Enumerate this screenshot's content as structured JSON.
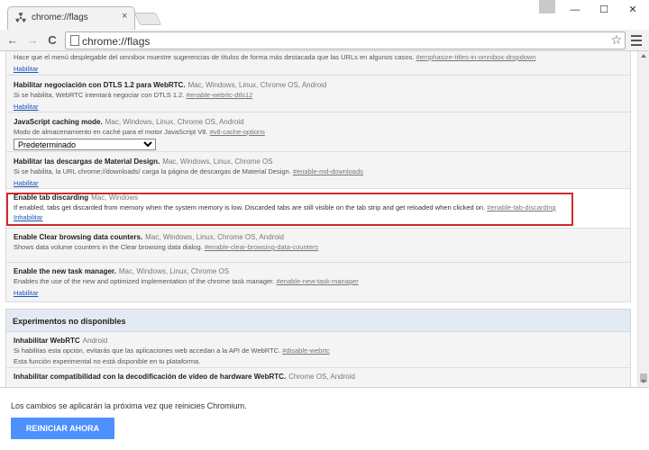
{
  "window": {
    "tab_title": "chrome://flags",
    "tab_close": "×",
    "minimize": "—",
    "maximize": "☐",
    "close": "✕"
  },
  "toolbar": {
    "back": "←",
    "forward": "→",
    "reload": "C",
    "url": "chrome://flags",
    "star": "☆"
  },
  "experiments": [
    {
      "name": "",
      "platforms": "",
      "desc": "Hace que el menú desplegable del omnibox muestre sugerencias de títulos de forma más destacada que las URLs en algunos casos.",
      "anchor": "#emphasize-titles-in-omnibox-dropdown",
      "action": "Habilitar"
    },
    {
      "name": "Habilitar negociación con DTLS 1.2 para WebRTC.",
      "platforms": "Mac, Windows, Linux, Chrome OS, Android",
      "desc": "Si se habilita, WebRTC intentará negociar con DTLS 1.2.",
      "anchor": "#enable-webrtc-dtls12",
      "action": "Habilitar"
    },
    {
      "name": "JavaScript caching mode.",
      "platforms": "Mac, Windows, Linux, Chrome OS, Android",
      "desc": "Modo de almacenamiento en caché para el motor JavaScript V8.",
      "anchor": "#v8-cache-options",
      "select_value": "Predeterminado"
    },
    {
      "name": "Habilitar las descargas de Material Design.",
      "platforms": "Mac, Windows, Linux, Chrome OS",
      "desc": "Si se habilita, la URL chrome://downloads/ carga la página de descargas de Material Design.",
      "anchor": "#enable-md-downloads",
      "action": "Habilitar"
    },
    {
      "name": "Enable tab discarding",
      "platforms": "Mac, Windows",
      "desc": "If enabled, tabs get discarded from memory when the system memory is low. Discarded tabs are still visible on the tab strip and get reloaded when clicked on.",
      "anchor": "#enable-tab-discarding",
      "action": "Inhabilitar"
    },
    {
      "name": "Enable Clear browsing data counters.",
      "platforms": "Mac, Windows, Linux, Chrome OS, Android",
      "desc": "Shows data volume counters in the Clear browsing data dialog.",
      "anchor": "#enable-clear-browsing-data-counters",
      "action": ""
    },
    {
      "name": "Enable the new task manager.",
      "platforms": "Mac, Windows, Linux, Chrome OS",
      "desc": "Enables the use of the new and optimized implementation of the chrome task manager.",
      "anchor": "#enable-new-task-manager",
      "action": "Habilitar"
    }
  ],
  "unavailable": {
    "heading": "Experimentos no disponibles",
    "items": [
      {
        "name": "Inhabilitar WebRTC",
        "platforms": "Android",
        "desc": "Si habilitas esta opción, evitarás que las aplicaciones web accedan a la API de WebRTC.",
        "anchor": "#disable-webrtc",
        "note": "Esta función experimental no está disponible en tu plataforma."
      },
      {
        "name": "Inhabilitar compatibilidad con la decodificación de vídeo de hardware WebRTC.",
        "platforms": "Chrome OS, Android",
        "desc": "",
        "anchor": ""
      }
    ]
  },
  "bottom": {
    "message": "Los cambios se aplicarán la próxima vez que reinicies Chromium.",
    "restart": "REINICIAR AHORA"
  }
}
